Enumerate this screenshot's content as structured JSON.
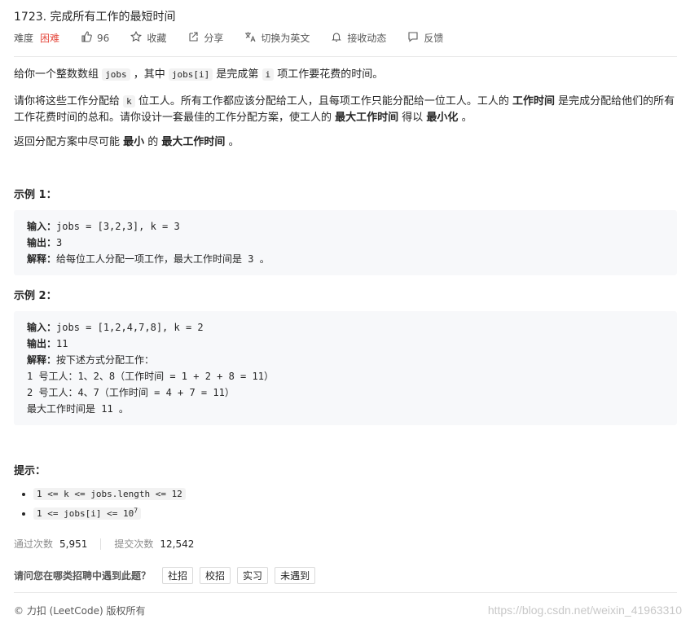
{
  "title": "1723. 完成所有工作的最短时间",
  "meta": {
    "difficulty_label": "难度",
    "difficulty_value": "困难",
    "likes": "96",
    "collect": "收藏",
    "share": "分享",
    "switch_lang": "切换为英文",
    "subscribe": "接收动态",
    "feedback": "反馈"
  },
  "desc": {
    "p1_a": "给你一个整数数组 ",
    "p1_code1": "jobs",
    "p1_b": " ，其中 ",
    "p1_code2": "jobs[i]",
    "p1_c": " 是完成第 ",
    "p1_code3": "i",
    "p1_d": " 项工作要花费的时间。",
    "p2_a": "请你将这些工作分配给 ",
    "p2_code1": "k",
    "p2_b": " 位工人。所有工作都应该分配给工人，且每项工作只能分配给一位工人。工人的 ",
    "p2_strong1": "工作时间",
    "p2_c": " 是完成分配给他们的所有工作花费时间的总和。请你设计一套最佳的工作分配方案，使工人的 ",
    "p2_strong2": "最大工作时间",
    "p2_d": " 得以 ",
    "p2_strong3": "最小化",
    "p2_e": " 。",
    "p3_a": "返回分配方案中尽可能 ",
    "p3_strong1": "最小",
    "p3_b": " 的 ",
    "p3_strong2": "最大工作时间",
    "p3_c": " 。"
  },
  "example1": {
    "heading": "示例 1：",
    "input_label": "输入：",
    "input_value": "jobs = [3,2,3], k = 3",
    "output_label": "输出：",
    "output_value": "3",
    "explain_label": "解释：",
    "explain_value": "给每位工人分配一项工作，最大工作时间是 3 。"
  },
  "example2": {
    "heading": "示例 2：",
    "input_label": "输入：",
    "input_value": "jobs = [1,2,4,7,8], k = 2",
    "output_label": "输出：",
    "output_value": "11",
    "explain_label": "解释：",
    "explain_value": "按下述方式分配工作：",
    "line1": "1 号工人：1、2、8（工作时间 = 1 + 2 + 8 = 11）",
    "line2": "2 号工人：4、7（工作时间 = 4 + 7 = 11）",
    "line3": "最大工作时间是 11 。"
  },
  "hints": {
    "heading": "提示：",
    "item1": "1 <= k <= jobs.length <= 12",
    "item2_base": "1 <= jobs[i] <= 10",
    "item2_sup": "7"
  },
  "stats": {
    "accepted_label": "通过次数",
    "accepted_value": "5,951",
    "submitted_label": "提交次数",
    "submitted_value": "12,542"
  },
  "ask": {
    "question": "请问您在哪类招聘中遇到此题？",
    "tags": [
      "社招",
      "校招",
      "实习",
      "未遇到"
    ]
  },
  "footer": "© 力扣 (LeetCode) 版权所有",
  "watermark": "https://blog.csdn.net/weixin_41963310"
}
